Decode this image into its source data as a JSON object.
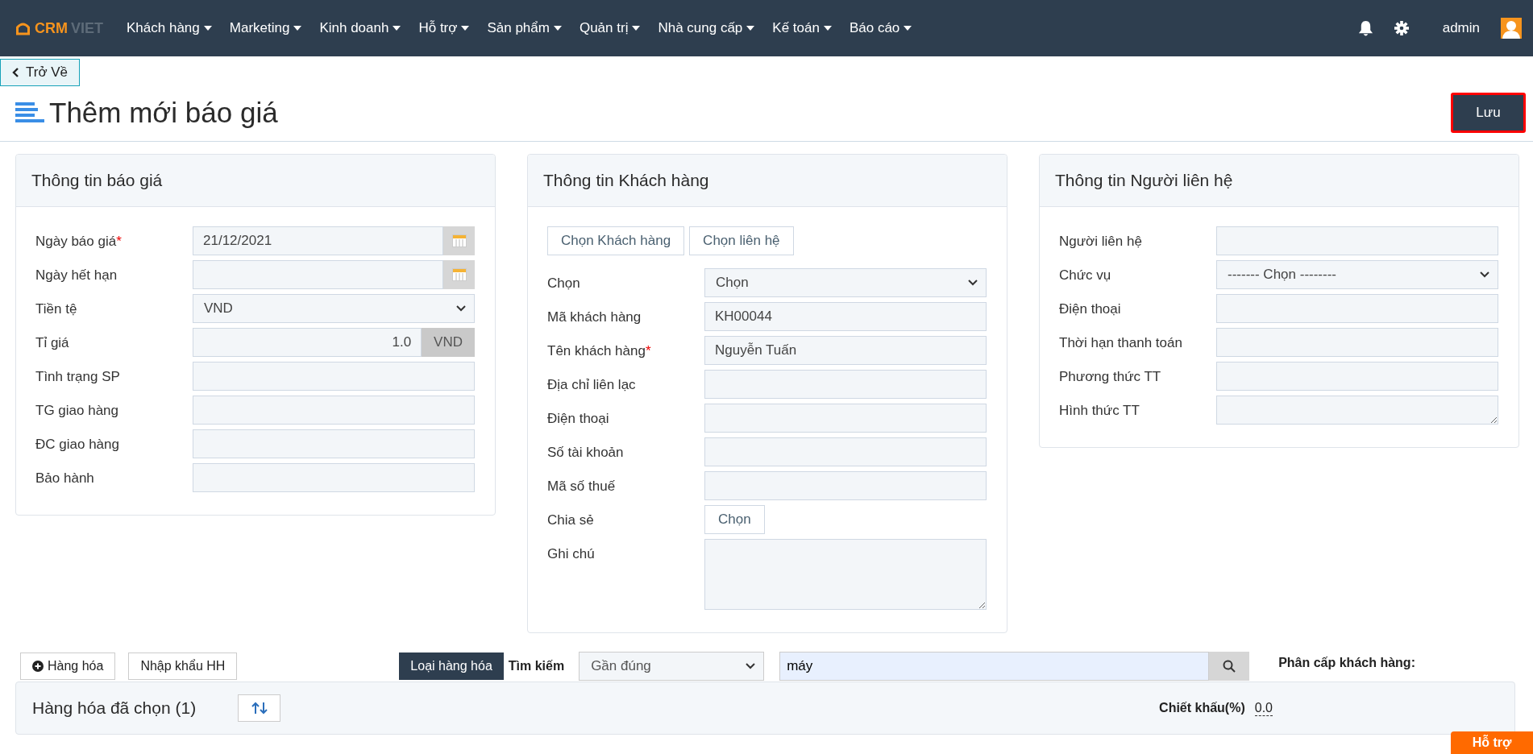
{
  "navbar": {
    "logo": {
      "text_1": "CRM",
      "text_2": "VIET"
    },
    "menu": [
      {
        "label": "Khách hàng"
      },
      {
        "label": "Marketing"
      },
      {
        "label": "Kinh doanh"
      },
      {
        "label": "Hỗ trợ"
      },
      {
        "label": "Sản phẩm"
      },
      {
        "label": "Quản trị"
      },
      {
        "label": "Nhà cung cấp"
      },
      {
        "label": "Kế toán"
      },
      {
        "label": "Báo cáo"
      }
    ],
    "user": "admin"
  },
  "back_button": "Trở Về",
  "page_title": "Thêm mới báo giá",
  "save_button": "Lưu",
  "panels": [
    {
      "title": "Thông tin báo giá",
      "fields": [
        {
          "label": "Ngày báo giá",
          "required_mark": "*",
          "kind": "date",
          "value": "21/12/2021"
        },
        {
          "label": "Ngày hết hạn",
          "kind": "date"
        },
        {
          "label": "Tiền tệ",
          "kind": "select",
          "value": "VND"
        },
        {
          "label": "Tỉ giá",
          "kind": "addon",
          "value": "1.0",
          "addon": "VND"
        },
        {
          "label": "Tình trạng SP",
          "kind": "text"
        },
        {
          "label": "TG giao hàng",
          "kind": "text"
        },
        {
          "label": "ĐC giao hàng",
          "kind": "text"
        },
        {
          "label": "Bảo hành",
          "kind": "text"
        }
      ]
    },
    {
      "title": "Thông tin Khách hàng",
      "actions": [
        "Chọn Khách hàng",
        "Chọn liên hệ"
      ],
      "fields": [
        {
          "label": "Chọn",
          "kind": "select",
          "value": "Chọn"
        },
        {
          "label": "Mã khách hàng",
          "kind": "text",
          "value": "KH00044"
        },
        {
          "label": "Tên khách hàng",
          "required_mark": "*",
          "kind": "text",
          "value": "Nguyễn Tuấn"
        },
        {
          "label": "Địa chỉ liên lạc",
          "kind": "text"
        },
        {
          "label": "Điện thoại",
          "kind": "text"
        },
        {
          "label": "Số tài khoản",
          "kind": "text"
        },
        {
          "label": "Mã số thuế",
          "kind": "text"
        },
        {
          "label": "Chia sẻ",
          "kind": "button",
          "value": "Chọn"
        },
        {
          "label": "Ghi chú",
          "kind": "textarea",
          "tall": true
        }
      ]
    },
    {
      "title": "Thông tin Người liên hệ",
      "fields": [
        {
          "label": "Người liên hệ",
          "kind": "text"
        },
        {
          "label": "Chức vụ",
          "kind": "select",
          "value": "------- Chọn --------"
        },
        {
          "label": "Điện thoại",
          "kind": "text"
        },
        {
          "label": "Thời hạn thanh toán",
          "kind": "text"
        },
        {
          "label": "Phương thức TT",
          "kind": "text"
        },
        {
          "label": "Hình thức TT",
          "kind": "textarea",
          "tall": false
        }
      ]
    }
  ],
  "product_toolbar": {
    "buttons": [
      {
        "kind": "add",
        "label": "Hàng hóa"
      },
      {
        "kind": "plain",
        "label": "Nhập khẩu HH"
      }
    ],
    "category_button": "Loại hàng hóa",
    "search_label": "Tìm kiếm",
    "match_select": "Gần đúng",
    "search_value": "máy",
    "customer_tier_label": "Phân cấp khách hàng:"
  },
  "selected_products": {
    "title": "Hàng hóa đã chọn (1)",
    "discount_label": "Chiết khấu(%)",
    "discount_value": "0.0"
  },
  "help_tab": "Hỗ trợ"
}
